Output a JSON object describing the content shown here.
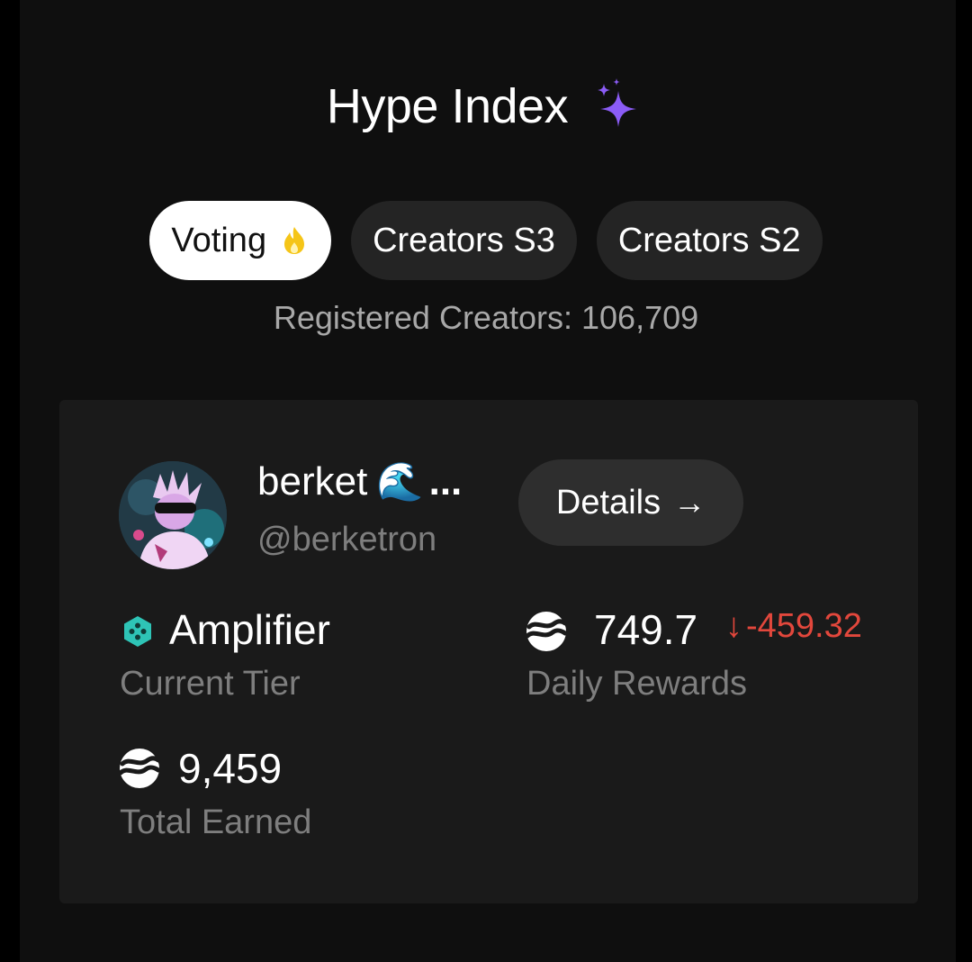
{
  "header": {
    "title": "Hype Index",
    "title_icon": "sparkles-icon"
  },
  "tabs": [
    {
      "label": "Voting",
      "icon": "flame-icon",
      "active": true
    },
    {
      "label": "Creators S3",
      "active": false
    },
    {
      "label": "Creators S2",
      "active": false
    }
  ],
  "registered": {
    "label": "Registered Creators:",
    "count": "106,709"
  },
  "profile": {
    "display_name": "berket",
    "emoji": "🌊",
    "ellipsis": "...",
    "handle": "@berketron",
    "details_label": "Details",
    "details_arrow": "→"
  },
  "stats": {
    "tier": {
      "value": "Amplifier",
      "label": "Current Tier",
      "icon": "amplifier-tier-icon"
    },
    "daily": {
      "value": "749.7",
      "change_arrow": "↓",
      "change": "-459.32",
      "label": "Daily Rewards",
      "icon": "coin-icon"
    },
    "total": {
      "value": "9,459",
      "label": "Total Earned",
      "icon": "coin-icon"
    }
  },
  "colors": {
    "accent_purple": "#8b5cf6",
    "negative": "#e2473c",
    "tier_teal": "#2ec4b6",
    "flame": "#f5c518"
  }
}
